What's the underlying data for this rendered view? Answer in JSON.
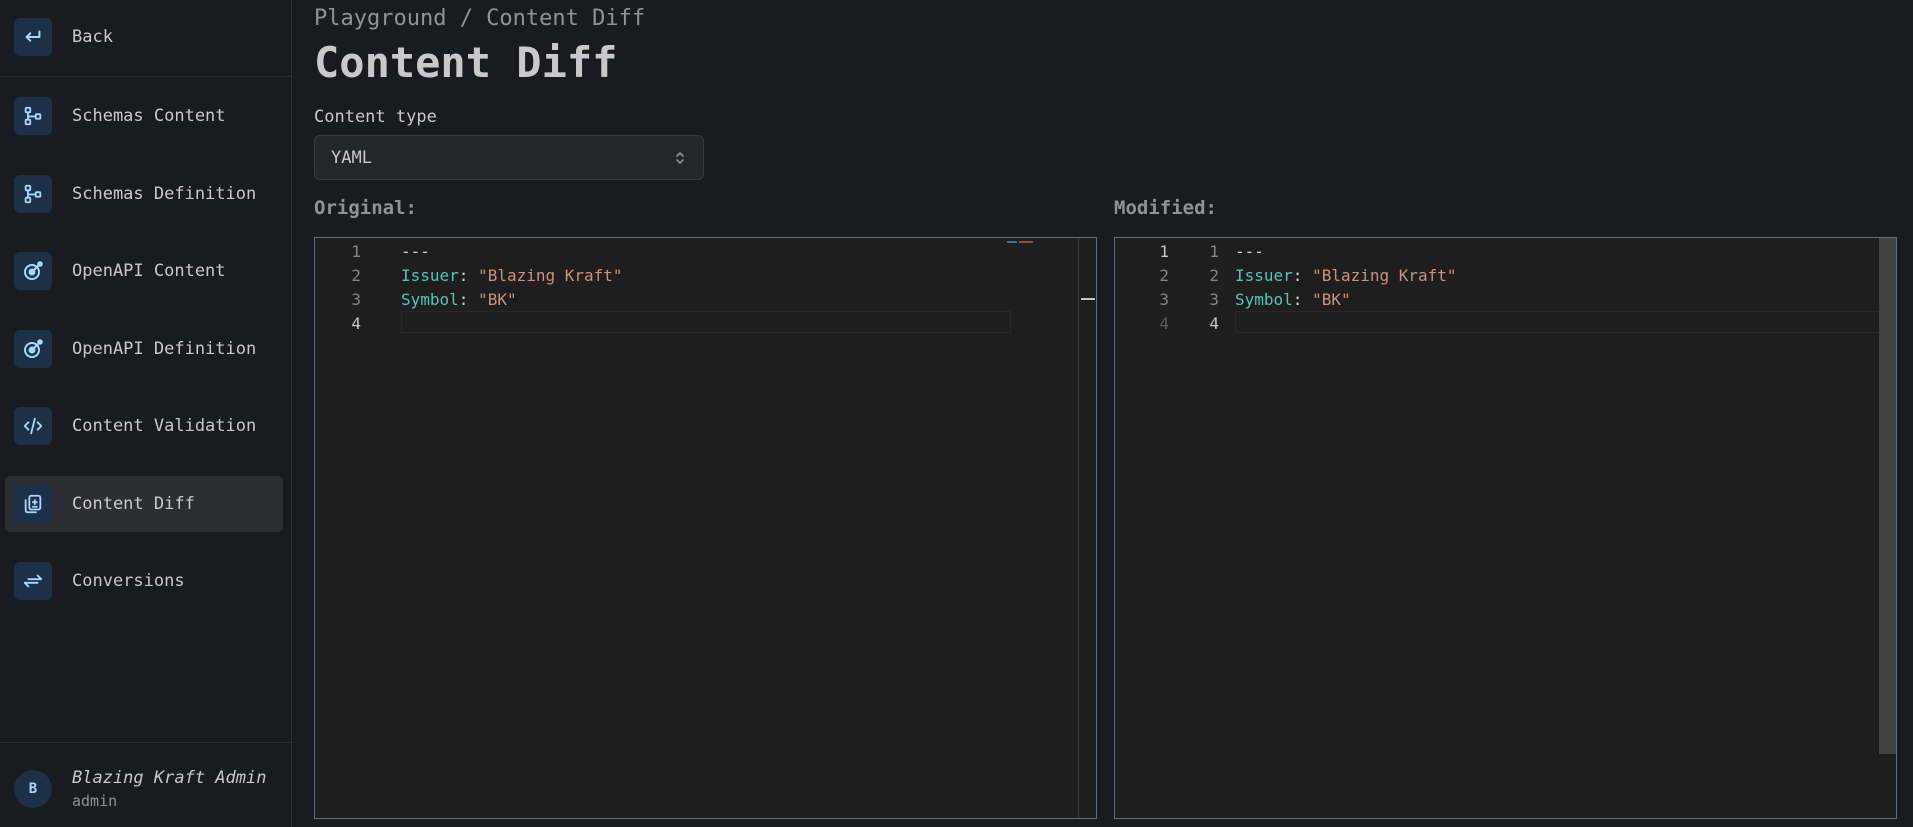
{
  "sidebar": {
    "back": {
      "label": "Back",
      "icon": "back-arrow-icon"
    },
    "items": [
      {
        "label": "Schemas Content",
        "icon": "schema-icon"
      },
      {
        "label": "Schemas Definition",
        "icon": "schema-icon"
      },
      {
        "label": "OpenAPI Content",
        "icon": "openapi-icon"
      },
      {
        "label": "OpenAPI Definition",
        "icon": "openapi-icon"
      },
      {
        "label": "Content Validation",
        "icon": "code-icon"
      },
      {
        "label": "Content Diff",
        "icon": "diff-icon",
        "active": true
      },
      {
        "label": "Conversions",
        "icon": "arrows-exchange-icon"
      }
    ],
    "user": {
      "initial": "B",
      "name": "Blazing Kraft Admin",
      "role": "admin"
    }
  },
  "header": {
    "breadcrumb": "Playground / Content Diff",
    "title": "Content Diff"
  },
  "content_type": {
    "label": "Content type",
    "value": "YAML"
  },
  "original": {
    "label": "Original:",
    "line_numbers": [
      "1",
      "2",
      "3",
      "4"
    ],
    "lines": [
      {
        "text": "---"
      },
      {
        "key": "Issuer",
        "sep": ": ",
        "value": "\"Blazing Kraft\""
      },
      {
        "key": "Symbol",
        "sep": ": ",
        "value": "\"BK\""
      },
      {
        "text": ""
      }
    ]
  },
  "modified": {
    "label": "Modified:",
    "orig_line_numbers": [
      "1",
      "2",
      "3",
      "4"
    ],
    "line_numbers": [
      "1",
      "2",
      "3",
      "4"
    ],
    "lines": [
      {
        "text": "---"
      },
      {
        "key": "Issuer",
        "sep": ": ",
        "value": "\"Blazing Kraft\""
      },
      {
        "key": "Symbol",
        "sep": ": ",
        "value": "\"BK\""
      },
      {
        "text": ""
      }
    ]
  },
  "colors": {
    "accent_bg": "#1c3048",
    "icon": "#a5d8ff",
    "yaml_key": "#4ec9b0",
    "yaml_string": "#ce9178"
  }
}
